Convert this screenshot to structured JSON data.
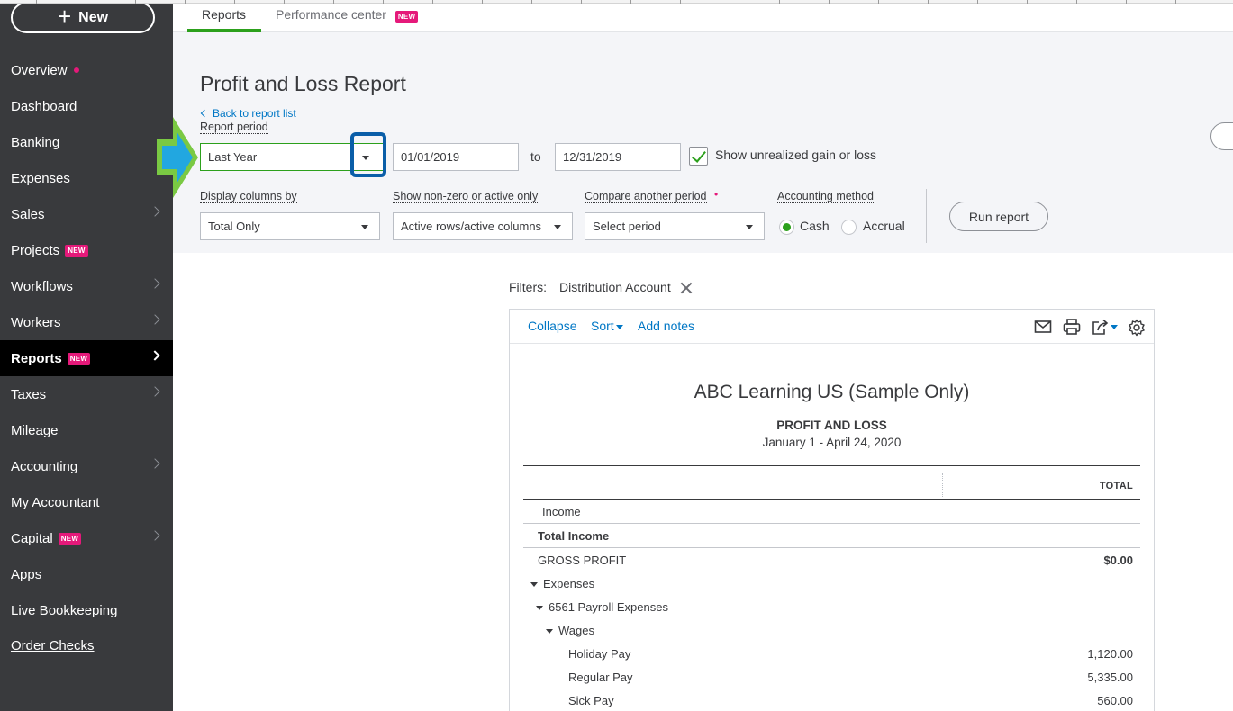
{
  "sidebar": {
    "new_label": "New",
    "items": [
      {
        "label": "Overview"
      },
      {
        "label": "Dashboard"
      },
      {
        "label": "Banking"
      },
      {
        "label": "Expenses"
      },
      {
        "label": "Sales"
      },
      {
        "label": "Projects",
        "badge": "NEW"
      },
      {
        "label": "Workflows"
      },
      {
        "label": "Workers"
      },
      {
        "label": "Reports",
        "badge": "NEW"
      },
      {
        "label": "Taxes"
      },
      {
        "label": "Mileage"
      },
      {
        "label": "Accounting"
      },
      {
        "label": "My Accountant"
      },
      {
        "label": "Capital",
        "badge": "NEW"
      },
      {
        "label": "Apps"
      },
      {
        "label": "Live Bookkeeping"
      },
      {
        "label": "Order Checks"
      }
    ]
  },
  "tabs": {
    "reports": "Reports",
    "performance": "Performance center",
    "performance_badge": "NEW"
  },
  "header": {
    "title": "Profit and Loss Report",
    "back_link": "Back to report list",
    "report_period_label": "Report period",
    "report_period_value": "Last Year",
    "date_from": "01/01/2019",
    "to_label": "to",
    "date_to": "12/31/2019",
    "unrealized_label": "Show unrealized gain or loss",
    "display_columns_label": "Display columns by",
    "display_columns_value": "Total Only",
    "nonzero_label": "Show non-zero or active only",
    "nonzero_value": "Active rows/active columns",
    "compare_label": "Compare another period",
    "compare_value": "Select period",
    "method_label": "Accounting method",
    "method_cash": "Cash",
    "method_accrual": "Accrual",
    "run_report": "Run report"
  },
  "filters": {
    "label": "Filters:",
    "value": "Distribution Account"
  },
  "report": {
    "toolbar": {
      "collapse": "Collapse",
      "sort": "Sort",
      "add_notes": "Add notes"
    },
    "company": "ABC Learning US (Sample Only)",
    "name": "PROFIT AND LOSS",
    "dates": "January 1 - April 24, 2020",
    "total_header": "TOTAL",
    "rows": [
      {
        "label": "Income",
        "value": ""
      },
      {
        "label": "Total Income",
        "value": ""
      },
      {
        "label": "GROSS PROFIT",
        "value": "$0.00"
      },
      {
        "label": "Expenses",
        "value": ""
      },
      {
        "label": "6561 Payroll Expenses",
        "value": ""
      },
      {
        "label": "Wages",
        "value": ""
      },
      {
        "label": "Holiday Pay",
        "value": "1,120.00"
      },
      {
        "label": "Regular Pay",
        "value": "5,335.00"
      },
      {
        "label": "Sick Pay",
        "value": "560.00"
      }
    ]
  },
  "colors": {
    "sidebar_bg": "#393a3d",
    "accent_green": "#2ca01c",
    "link_blue": "#0077c5",
    "badge_pink": "#e5197a",
    "highlight_blue": "#0a5ea8"
  }
}
